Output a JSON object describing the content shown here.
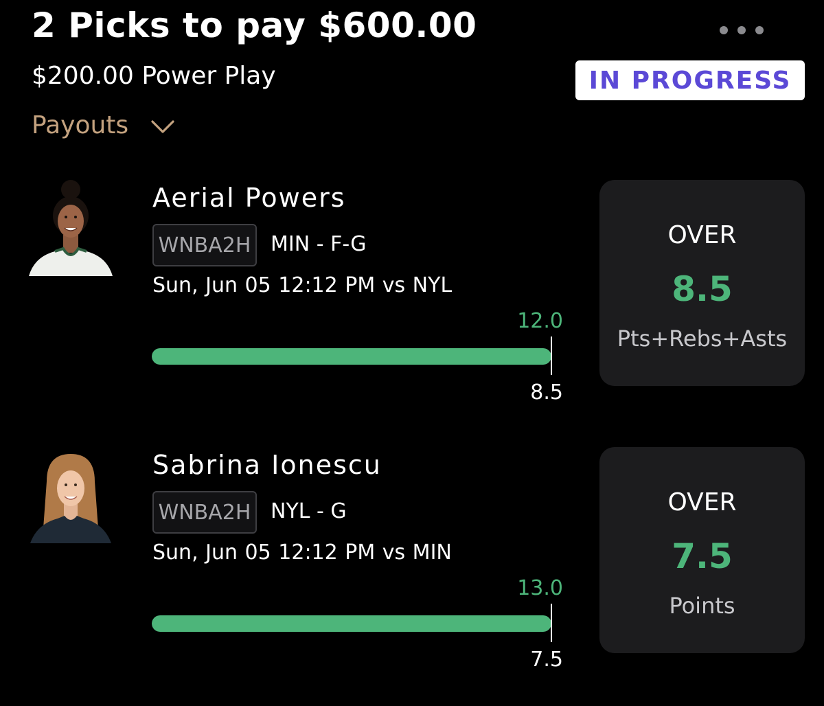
{
  "header": {
    "title": "2 Picks to pay $600.00",
    "subtitle": "$200.00 Power Play",
    "status": "IN PROGRESS",
    "payouts_label": "Payouts",
    "more_icon": "more-horizontal-icon",
    "payouts_icon": "chevron-down-icon"
  },
  "colors": {
    "background": "#000000",
    "accent_green": "#4db57a",
    "status_text": "#5b49d6",
    "payouts_text": "#c4a27f",
    "card_bg": "#1c1c1e"
  },
  "picks": [
    {
      "player": "Aerial Powers",
      "league": "WNBA2H",
      "team_pos": "MIN - F-G",
      "game": "Sun, Jun 05 12:12 PM  vs NYL",
      "actual": "12.0",
      "line": "8.5",
      "direction": "OVER",
      "stat": "Pts+Rebs+Asts",
      "progress_fraction": 1.0
    },
    {
      "player": "Sabrina Ionescu",
      "league": "WNBA2H",
      "team_pos": "NYL - G",
      "game": "Sun, Jun 05 12:12 PM  vs MIN",
      "actual": "13.0",
      "line": "7.5",
      "direction": "OVER",
      "stat": "Points",
      "progress_fraction": 1.0
    }
  ]
}
